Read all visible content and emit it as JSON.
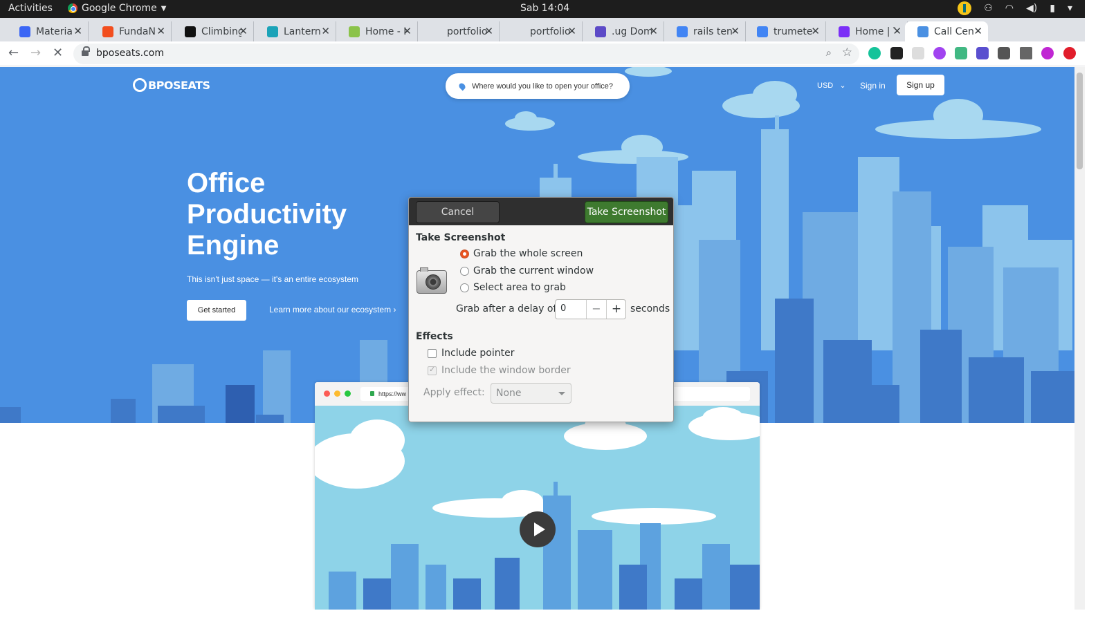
{
  "topbar": {
    "activities": "Activities",
    "app_name": "Google Chrome",
    "clock": "Sab 14:04",
    "tray_icons": [
      "lantern-icon",
      "network-user-icon",
      "wifi-icon",
      "volume-icon",
      "battery-icon"
    ]
  },
  "tabs": [
    {
      "label": "Materia",
      "favicon": "materialize-icon",
      "color": "#3b66f5"
    },
    {
      "label": "FundaN",
      "favicon": "figma-icon",
      "color": "#f24e1e"
    },
    {
      "label": "Climbing",
      "favicon": "hi-icon",
      "color": "#111111"
    },
    {
      "label": "Lantern",
      "favicon": "lantern-icon",
      "color": "#1ba3b8"
    },
    {
      "label": "Home - F",
      "favicon": "leaf-icon",
      "color": "#8bc34a"
    },
    {
      "label": "portfolio",
      "favicon": "page-icon",
      "color": "#dee1e6"
    },
    {
      "label": "portfolio",
      "favicon": "page-icon",
      "color": "#dee1e6"
    },
    {
      "label": ".ug Dom",
      "favicon": "ug-icon",
      "color": "#5c4ac7"
    },
    {
      "label": "rails ten",
      "favicon": "google-icon",
      "color": "#4285f4"
    },
    {
      "label": "trumete",
      "favicon": "google-icon",
      "color": "#4285f4"
    },
    {
      "label": "Home | T",
      "favicon": "arrow-icon",
      "color": "#7b2ff7"
    },
    {
      "label": "Call Cen",
      "favicon": "bposeats-icon",
      "color": "#4a90e2",
      "active": true
    }
  ],
  "toolbar": {
    "url": "bposeats.com",
    "extensions": [
      "grammarly-icon",
      "extension-icon",
      "extension-icon",
      "extension-icon",
      "vue-icon",
      "extension-icon",
      "dj-icon",
      "puzzle-icon",
      "avatar-icon",
      "extension-icon"
    ]
  },
  "site": {
    "logo_text": "BPOSEATS",
    "location_placeholder": "Where would you like to open your office?",
    "currency": "USD",
    "sign_in": "Sign in",
    "sign_up": "Sign up",
    "hero_title": "Office Productivity Engine",
    "hero_subtitle": "This isn't just space — it's an entire ecosystem",
    "get_started": "Get started",
    "learn_more": "Learn more about our ecosystem",
    "preview_url": "https://ww",
    "colors": {
      "hero_bg": "#4a90e2",
      "preview_sky": "#8ed3e8"
    }
  },
  "dialog": {
    "cancel": "Cancel",
    "take_screenshot": "Take Screenshot",
    "section_title": "Take Screenshot",
    "options": [
      {
        "label": "Grab the whole screen",
        "selected": true
      },
      {
        "label": "Grab the current window",
        "selected": false
      },
      {
        "label": "Select area to grab",
        "selected": false
      }
    ],
    "delay_label": "Grab after a delay of",
    "delay_value": "0",
    "delay_unit": "seconds",
    "effects_title": "Effects",
    "include_pointer": "Include pointer",
    "include_border": "Include the window border",
    "apply_effect_label": "Apply effect:",
    "apply_effect_value": "None",
    "accent_color": "#3e7a2f"
  }
}
